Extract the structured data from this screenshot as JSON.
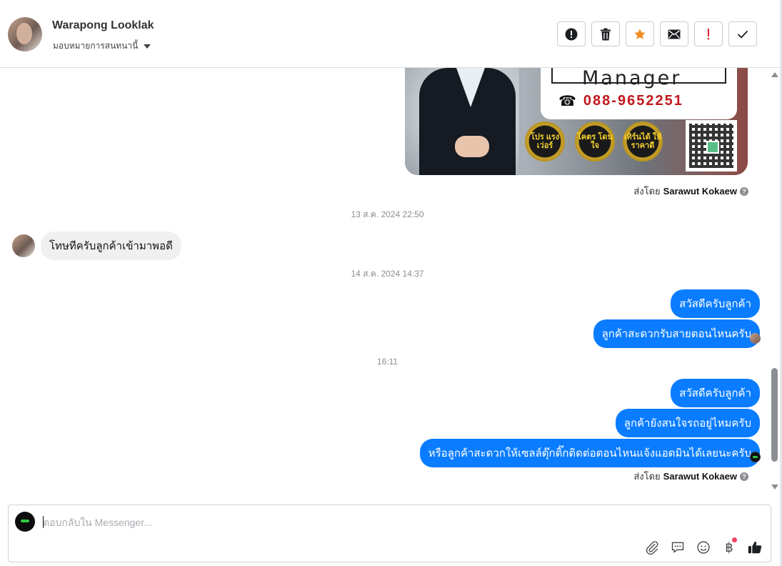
{
  "header": {
    "contact_name": "Warapong Looklak",
    "assign_label": "มอบหมายการสนทนานี้",
    "toolbar": [
      {
        "name": "spam-button",
        "icon": "alert-circle-icon"
      },
      {
        "name": "delete-button",
        "icon": "trash-icon"
      },
      {
        "name": "star-button",
        "icon": "star-icon"
      },
      {
        "name": "mark-unread-button",
        "icon": "envelope-icon"
      },
      {
        "name": "important-button",
        "icon": "exclamation-icon"
      },
      {
        "name": "done-button",
        "icon": "check-icon"
      }
    ]
  },
  "banner": {
    "title": "Manager",
    "phone": "088-9652251",
    "badges": [
      "โปร แรง เว่อร์",
      "โคตร โดนใจ",
      "เทิร์นได้ ให้ราคาดี"
    ]
  },
  "sent_by_prefix": "ส่งโดย",
  "sent_by_name": "Sarawut Kokaew",
  "messages": {
    "ts1": "13 ส.ค. 2024 22:50",
    "incoming1": "โทษทีครับลูกค้าเข้ามาพอดี",
    "ts2": "14 ส.ค. 2024 14:37",
    "out1": "สวัสดีครับลูกค้า",
    "out2": "ลูกค้าสะดวกรับสายตอนไหนครับ",
    "ts3": "16:11",
    "out3": "สวัสดีครับลูกค้า",
    "out4": "ลูกค้ายังสนใจรถอยู่ไหมครับ",
    "out5": "หรือลูกค้าสะดวกให้เซลล์ตุ๊กติ๊กติดต่อตอนไหนแจ้งแอดมินได้เลยนะครับ"
  },
  "composer": {
    "placeholder": "ตอบกลับใน Messenger...",
    "tools": [
      "paperclip-icon",
      "saved-reply-icon",
      "emoji-icon",
      "baht-payment-icon",
      "thumbs-up-icon"
    ]
  },
  "colors": {
    "accent": "#0a7cff",
    "star": "#f28c1e",
    "important": "#e4212c"
  }
}
